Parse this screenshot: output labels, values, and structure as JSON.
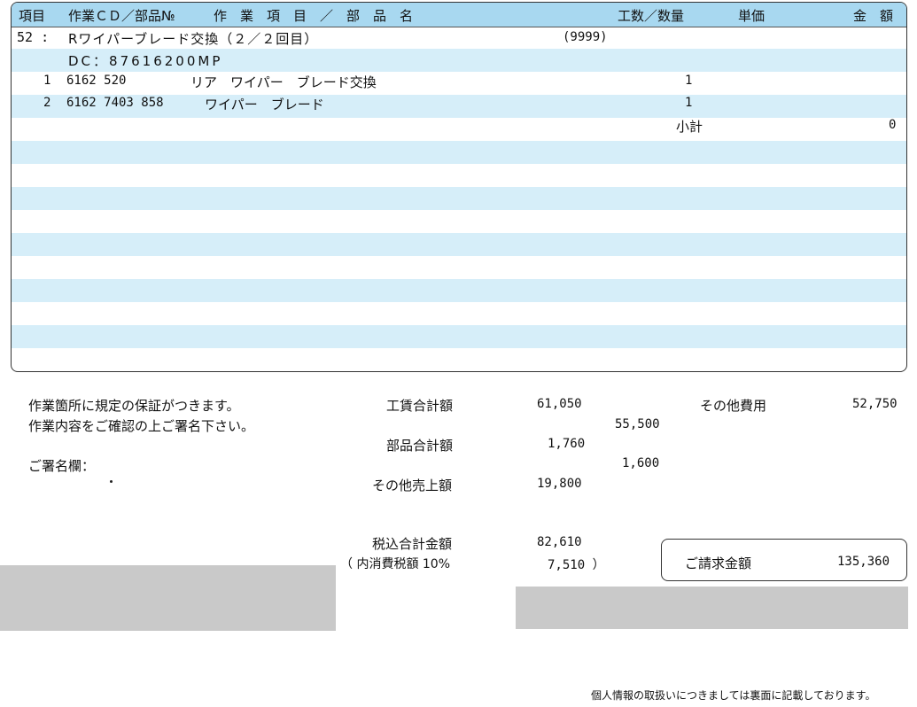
{
  "table": {
    "headers": {
      "item": "項目",
      "code": "作業ＣＤ／部品№",
      "name": "作　業　項　目　／　部　品　名",
      "qty": "工数／数量",
      "unit_price": "単価",
      "amount": "金　額"
    },
    "job": {
      "number": "52 :",
      "title": "Rワイパーブレード交換（２／２回目）",
      "ref": "(9999)",
      "dc": "DC：87616200MP"
    },
    "lines": [
      {
        "no": "1",
        "code": "6162 520",
        "name": "リア　ワイパー　ブレード交換",
        "qty": "1"
      },
      {
        "no": "2",
        "code": "6162 7403 858",
        "name": "ワイパー　ブレード",
        "qty": "1"
      }
    ],
    "subtotal_label": "小計",
    "subtotal_value": "0"
  },
  "notes": {
    "warranty": "作業箇所に規定の保証がつきます。",
    "confirm": "作業内容をご確認の上ご署名下さい。",
    "signature_label": "ご署名欄："
  },
  "totals": {
    "labor_label": "工賃合計額",
    "labor_value": "61,050",
    "labor_sub": "55,500",
    "parts_label": "部品合計額",
    "parts_value": "1,760",
    "parts_sub": "1,600",
    "other_sales_label": "その他売上額",
    "other_sales_value": "19,800",
    "other_fees_label": "その他費用",
    "other_fees_value": "52,750",
    "tax_total_label": "税込合計金額",
    "tax_total_value": "82,610",
    "tax_inner_label": "（ 内消費税額 10%",
    "tax_inner_value": "7,510 ）",
    "invoice_label": "ご請求金額",
    "invoice_value": "135,360"
  },
  "footer": {
    "privacy": "個人情報の取扱いにつきましては裏面に記載しております。"
  },
  "colors": {
    "header_bg": "#a8d8f0",
    "stripe_bg": "#d6eef9",
    "redaction": "#c9c9c9"
  }
}
